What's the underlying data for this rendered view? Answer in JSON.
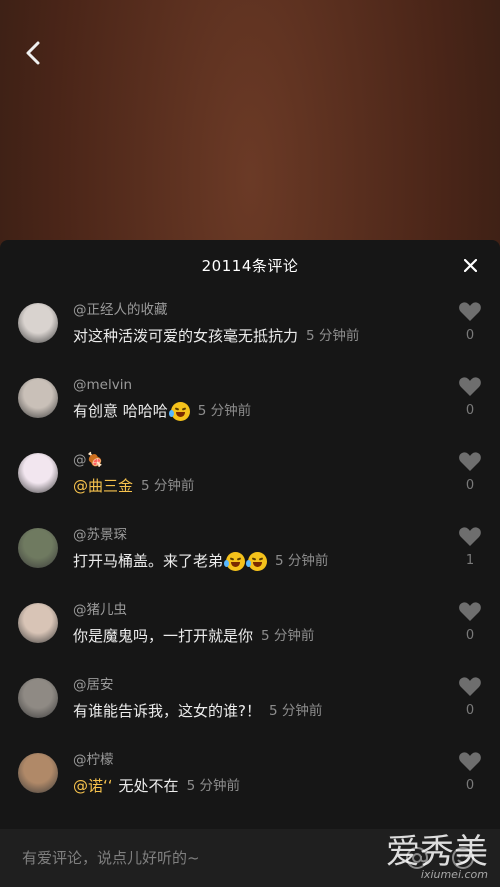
{
  "header": {
    "title": "20114条评论"
  },
  "comments": [
    {
      "username": "@正经人的收藏",
      "text": "对这种活泼可爱的女孩毫无抵抗力",
      "mention": "",
      "emojis": 0,
      "time": "5 分钟前",
      "likes": "0",
      "avatar_color": "#d9d3cf"
    },
    {
      "username": "@melvin",
      "text": "有创意 哈哈哈",
      "mention": "",
      "emojis": 1,
      "time": "5 分钟前",
      "likes": "0",
      "avatar_color": "#c9c0b8"
    },
    {
      "username": "@🍖",
      "text": "",
      "mention": "@曲三金",
      "emojis": 0,
      "time": "5 分钟前",
      "likes": "0",
      "avatar_color": "#f2e6ef"
    },
    {
      "username": "@苏景琛",
      "text": "打开马桶盖。来了老弟",
      "mention": "",
      "emojis": 2,
      "time": "5 分钟前",
      "likes": "1",
      "avatar_color": "#6f7a60"
    },
    {
      "username": "@猪儿虫",
      "text": "你是魔鬼吗，一打开就是你",
      "mention": "",
      "emojis": 0,
      "time": "5 分钟前",
      "likes": "0",
      "avatar_color": "#d8c4b6"
    },
    {
      "username": "@居安",
      "text": "有谁能告诉我，这女的谁?！",
      "mention": "",
      "emojis": 0,
      "time": "5 分钟前",
      "likes": "0",
      "avatar_color": "#8f8a84"
    },
    {
      "username": "@柠檬",
      "text": "无处不在",
      "mention": "@诺ʻʻ",
      "emojis": 0,
      "time": "5 分钟前",
      "likes": "0",
      "avatar_color": "#b08968"
    }
  ],
  "input": {
    "placeholder": "有爱评论，说点儿好听的~"
  },
  "watermark": {
    "main": "爱秀美",
    "sub": "ixiumei.com"
  },
  "colors": {
    "mention": "#f6c24d",
    "sheet_bg": "#161616",
    "muted": "#8d8d8d"
  },
  "icons": {
    "back": "chevron-left-icon",
    "close": "close-icon",
    "like": "heart-icon",
    "at": "at-icon",
    "emoji": "smiley-icon"
  }
}
